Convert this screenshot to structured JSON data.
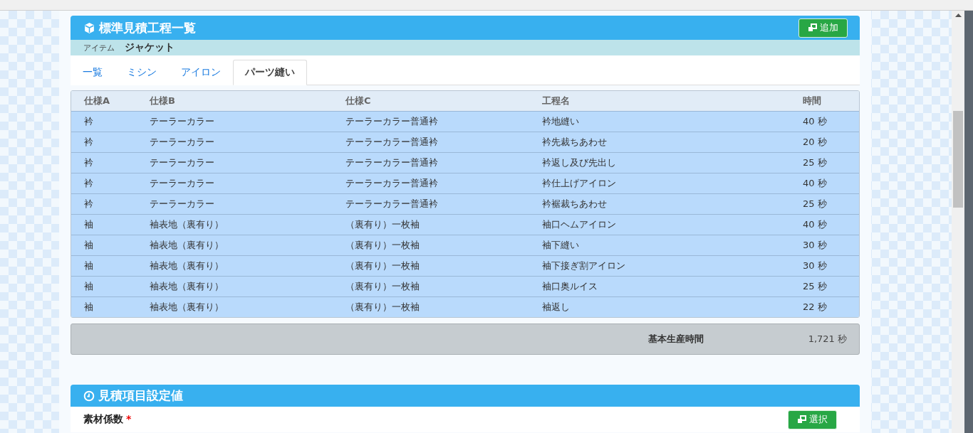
{
  "panel": {
    "title": "標準見積工程一覧",
    "add_button": "追加",
    "item_label": "アイテム",
    "item_value": "ジャケット"
  },
  "tabs": [
    {
      "label": "一覧",
      "selected": false
    },
    {
      "label": "ミシン",
      "selected": false
    },
    {
      "label": "アイロン",
      "selected": false
    },
    {
      "label": "パーツ縫い",
      "selected": true
    }
  ],
  "table": {
    "columns": [
      "仕様A",
      "仕様B",
      "仕様C",
      "工程名",
      "時間"
    ],
    "rows": [
      [
        "衿",
        "テーラーカラー",
        "テーラーカラー普通衿",
        "衿地縫い",
        "40 秒"
      ],
      [
        "衿",
        "テーラーカラー",
        "テーラーカラー普通衿",
        "衿先裁ちあわせ",
        "20 秒"
      ],
      [
        "衿",
        "テーラーカラー",
        "テーラーカラー普通衿",
        "衿返し及び先出し",
        "25 秒"
      ],
      [
        "衿",
        "テーラーカラー",
        "テーラーカラー普通衿",
        "衿仕上げアイロン",
        "40 秒"
      ],
      [
        "衿",
        "テーラーカラー",
        "テーラーカラー普通衿",
        "衿裾裁ちあわせ",
        "25 秒"
      ],
      [
        "袖",
        "袖表地（裏有り）",
        "（裏有り）一枚袖",
        "袖口ヘムアイロン",
        "40 秒"
      ],
      [
        "袖",
        "袖表地（裏有り）",
        "（裏有り）一枚袖",
        "袖下縫い",
        "30 秒"
      ],
      [
        "袖",
        "袖表地（裏有り）",
        "（裏有り）一枚袖",
        "袖下接ぎ割アイロン",
        "30 秒"
      ],
      [
        "袖",
        "袖表地（裏有り）",
        "（裏有り）一枚袖",
        "袖口奥ルイス",
        "25 秒"
      ],
      [
        "袖",
        "袖表地（裏有り）",
        "（裏有り）一枚袖",
        "袖返し",
        "22 秒"
      ]
    ]
  },
  "total": {
    "label": "基本生産時間",
    "value": "1,721 秒"
  },
  "settings": {
    "title": "見積項目設定値",
    "field_label": "素材係数",
    "required_mark": "*",
    "select_button": "選択"
  }
}
